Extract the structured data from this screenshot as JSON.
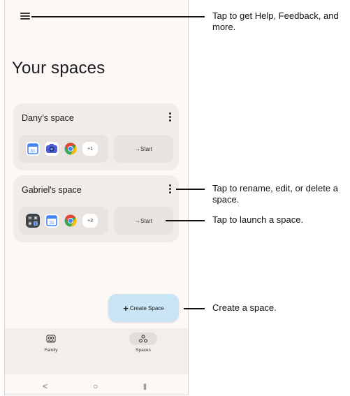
{
  "page": {
    "title": "Your spaces"
  },
  "spaces": [
    {
      "name": "Dany’s space",
      "apps": [
        "calendar",
        "camera",
        "chrome"
      ],
      "calendar_day": "31",
      "more": "+1",
      "start_label": "→Start"
    },
    {
      "name": "Gabriel's space",
      "apps": [
        "calculator",
        "calendar",
        "chrome"
      ],
      "calendar_day": "31",
      "more": "+3",
      "start_label": "→Start"
    }
  ],
  "fab": {
    "label": "Create Space",
    "plus": "+"
  },
  "bottom_nav": [
    {
      "label": "Family",
      "icon": "family-icon",
      "active": false
    },
    {
      "label": "Spaces",
      "icon": "spaces-icon",
      "active": true
    }
  ],
  "system_nav": {
    "back": "<",
    "home": "○",
    "recents": "|||"
  },
  "callouts": {
    "menu": "Tap to get Help, Feedback, and more.",
    "kebab": "Tap to rename, edit, or delete a space.",
    "start": "Tap to launch a space.",
    "create": "Create a space."
  },
  "colors": {
    "background": "#fbf8f5",
    "card": "#f1ece8",
    "fab": "#c9e4f5",
    "google_blue": "#4285F4",
    "google_red": "#EA4335",
    "google_yellow": "#FBBC05",
    "google_green": "#34A853"
  }
}
